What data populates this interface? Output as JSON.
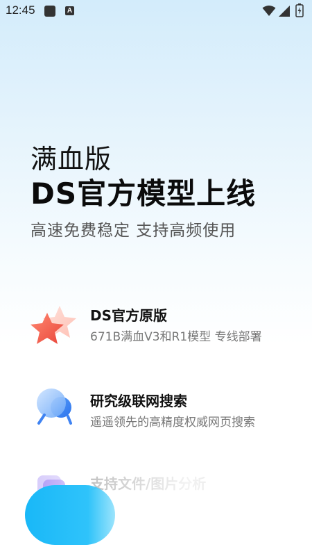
{
  "status_bar": {
    "time": "12:45",
    "notification_icons": [
      "app-square-icon",
      "a-badge-icon"
    ],
    "right_icons": [
      "wifi-icon",
      "cellular-icon",
      "battery-icon"
    ]
  },
  "hero": {
    "subtitle": "满血版",
    "title": "DS官方模型上线",
    "tagline": "高速免费稳定 支持高频使用"
  },
  "features": [
    {
      "icon": "star-icon",
      "title": "DS官方原版",
      "description": "671B满血V3和R1模型 专线部署"
    },
    {
      "icon": "globe-search-icon",
      "title": "研究级联网搜索",
      "description": "遥遥领先的高精度权威网页搜索"
    },
    {
      "icon": "file-image-icon",
      "title": "支持文件/图片分析",
      "description": ""
    }
  ],
  "colors": {
    "accent": "#1cb9f8",
    "star_red": "#ef6250",
    "search_blue": "#4a8ef5",
    "file_purple": "#8b6cf2"
  }
}
